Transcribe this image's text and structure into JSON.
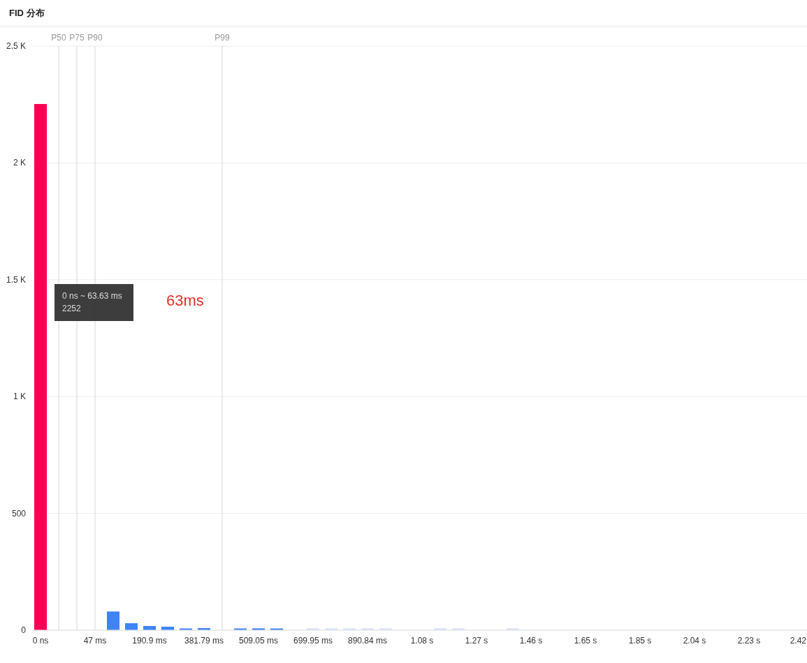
{
  "panel": {
    "title": "FID 分布",
    "chart_data": {
      "type": "bar",
      "yticks": [
        {
          "value": 0,
          "label": "0"
        },
        {
          "value": 500,
          "label": "500"
        },
        {
          "value": 1000,
          "label": "1 K"
        },
        {
          "value": 1500,
          "label": "1.5 K"
        },
        {
          "value": 2000,
          "label": "2 K"
        },
        {
          "value": 2500,
          "label": "2.5 K"
        }
      ],
      "ylim": [
        0,
        2500
      ],
      "categories": [
        "0 ns",
        null,
        null,
        "47 ms",
        null,
        null,
        "190.9 ms",
        null,
        null,
        "381.79 ms",
        null,
        null,
        "509.05 ms",
        null,
        null,
        "699.95 ms",
        null,
        null,
        "890.84 ms",
        null,
        null,
        "1.08 s",
        null,
        null,
        "1.27 s",
        null,
        null,
        "1.46 s",
        null,
        null,
        "1.65 s",
        null,
        null,
        "1.85 s",
        null,
        null,
        "2.04 s",
        null,
        null,
        "2.23 s",
        null,
        null,
        "2.42"
      ],
      "series": [
        {
          "color": "#ff0055",
          "values": [
            2252,
            null,
            null,
            null,
            null,
            null,
            null,
            null,
            null,
            null,
            null,
            null,
            null,
            null,
            null,
            null,
            null,
            null,
            null,
            null,
            null,
            null,
            null,
            null,
            null,
            null,
            null,
            null,
            null,
            null,
            null,
            null,
            null,
            null,
            null,
            null,
            null,
            null,
            null,
            null,
            null,
            null,
            null
          ]
        },
        {
          "color": "#3f84f7",
          "values": [
            null,
            null,
            null,
            null,
            80,
            30,
            18,
            15,
            6,
            9,
            null,
            5,
            8,
            5,
            null,
            null,
            null,
            null,
            null,
            null,
            null,
            null,
            null,
            null,
            null,
            null,
            null,
            null,
            null,
            null,
            null,
            null,
            null,
            null,
            null,
            null,
            null,
            null,
            null,
            null,
            null,
            null,
            null
          ]
        },
        {
          "color": "#d3def5",
          "values": [
            null,
            null,
            null,
            null,
            null,
            null,
            null,
            null,
            null,
            null,
            null,
            null,
            null,
            null,
            null,
            6,
            6,
            6,
            6,
            6,
            null,
            null,
            6,
            6,
            null,
            null,
            6,
            null,
            null,
            null,
            null,
            null,
            null,
            null,
            null,
            null,
            null,
            null,
            null,
            null,
            null,
            null,
            null
          ]
        }
      ],
      "annotations": [
        "P50",
        "P75",
        "P90",
        "P99"
      ],
      "grid": true
    },
    "tooltip": {
      "range": "0 ns ~ 63.63 ms",
      "count": "2252"
    },
    "note": "63ms"
  }
}
